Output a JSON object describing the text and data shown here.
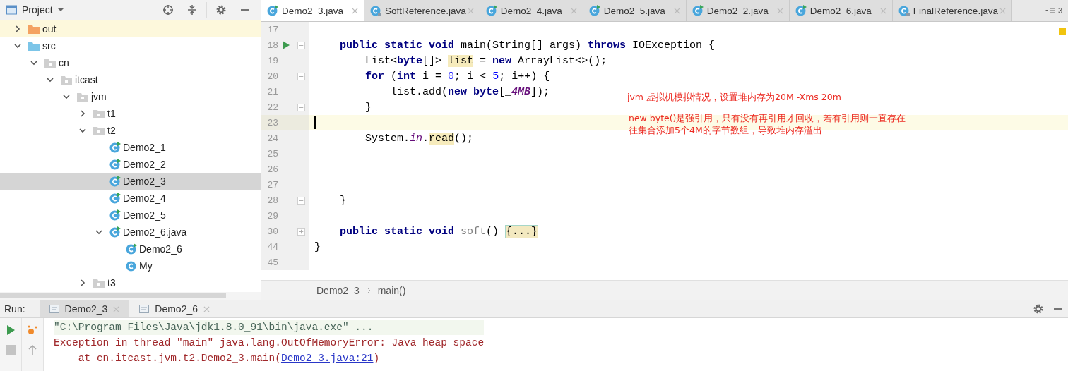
{
  "project_panel": {
    "title": "Project",
    "tree": [
      {
        "label": "out",
        "kind": "excluded-folder",
        "expanded": false,
        "selected": false
      },
      {
        "label": "src",
        "kind": "source-folder",
        "expanded": true,
        "selected": false,
        "children": [
          {
            "label": "cn",
            "kind": "package",
            "expanded": true,
            "selected": false,
            "children": [
              {
                "label": "itcast",
                "kind": "package",
                "expanded": true,
                "selected": false,
                "children": [
                  {
                    "label": "jvm",
                    "kind": "package",
                    "expanded": true,
                    "selected": false,
                    "children": [
                      {
                        "label": "t1",
                        "kind": "package",
                        "expanded": false,
                        "selected": false
                      },
                      {
                        "label": "t2",
                        "kind": "package",
                        "expanded": true,
                        "selected": false,
                        "children": [
                          {
                            "label": "Demo2_1",
                            "kind": "runnable-class",
                            "selected": false
                          },
                          {
                            "label": "Demo2_2",
                            "kind": "runnable-class",
                            "selected": false
                          },
                          {
                            "label": "Demo2_3",
                            "kind": "runnable-class",
                            "selected": true
                          },
                          {
                            "label": "Demo2_4",
                            "kind": "runnable-class",
                            "selected": false
                          },
                          {
                            "label": "Demo2_5",
                            "kind": "runnable-class",
                            "selected": false
                          },
                          {
                            "label": "Demo2_6.java",
                            "kind": "runnable-class",
                            "expanded": true,
                            "selected": false,
                            "children": [
                              {
                                "label": "Demo2_6",
                                "kind": "runnable-class",
                                "selected": false
                              },
                              {
                                "label": "My",
                                "kind": "class",
                                "selected": false
                              }
                            ]
                          }
                        ]
                      },
                      {
                        "label": "t3",
                        "kind": "package",
                        "expanded": false,
                        "selected": false
                      }
                    ]
                  }
                ]
              }
            ]
          }
        ]
      }
    ]
  },
  "editor": {
    "tabs": [
      {
        "label": "Demo2_3.java",
        "kind": "runnable-class",
        "selected": true
      },
      {
        "label": "SoftReference.java",
        "kind": "library-class",
        "selected": false
      },
      {
        "label": "Demo2_4.java",
        "kind": "runnable-class",
        "selected": false
      },
      {
        "label": "Demo2_5.java",
        "kind": "runnable-class",
        "selected": false
      },
      {
        "label": "Demo2_2.java",
        "kind": "runnable-class",
        "selected": false
      },
      {
        "label": "Demo2_6.java",
        "kind": "runnable-class",
        "selected": false
      },
      {
        "label": "FinalReference.java",
        "kind": "library-class",
        "selected": false
      }
    ],
    "overflow_count": "3",
    "lines": [
      {
        "number": "17",
        "kind": "plain",
        "run": false,
        "current": false
      },
      {
        "number": "18",
        "kind": "fold-start",
        "run": true,
        "current": false,
        "tokens": [
          {
            "text": "    public static void",
            "kind": "keyword"
          },
          {
            "text": " main(String[] args) ",
            "kind": "plain"
          },
          {
            "text": "throws",
            "kind": "keyword"
          },
          {
            "text": " IOException {",
            "kind": "plain"
          }
        ]
      },
      {
        "number": "19",
        "kind": "plain",
        "run": false,
        "current": false,
        "tokens": [
          {
            "text": "        List<",
            "kind": "plain"
          },
          {
            "text": "byte",
            "kind": "keyword"
          },
          {
            "text": "[]> ",
            "kind": "plain"
          },
          {
            "text": "list",
            "kind": "highlight"
          },
          {
            "text": " = ",
            "kind": "plain"
          },
          {
            "text": "new",
            "kind": "keyword"
          },
          {
            "text": " ArrayList<>();",
            "kind": "plain"
          }
        ]
      },
      {
        "number": "20",
        "kind": "fold-start",
        "run": false,
        "current": false,
        "tokens": [
          {
            "text": "        for",
            "kind": "keyword"
          },
          {
            "text": " (",
            "kind": "plain"
          },
          {
            "text": "int ",
            "kind": "keyword"
          },
          {
            "text": "i",
            "kind": "variable"
          },
          {
            "text": " = ",
            "kind": "plain"
          },
          {
            "text": "0",
            "kind": "number"
          },
          {
            "text": "; ",
            "kind": "plain"
          },
          {
            "text": "i",
            "kind": "variable"
          },
          {
            "text": " < ",
            "kind": "plain"
          },
          {
            "text": "5",
            "kind": "number"
          },
          {
            "text": "; ",
            "kind": "plain"
          },
          {
            "text": "i",
            "kind": "variable"
          },
          {
            "text": "++) {",
            "kind": "plain"
          }
        ]
      },
      {
        "number": "21",
        "kind": "plain",
        "run": false,
        "current": false,
        "tokens": [
          {
            "text": "            list.add(",
            "kind": "plain"
          },
          {
            "text": "new byte",
            "kind": "keyword"
          },
          {
            "text": "[_",
            "kind": "plain"
          },
          {
            "text": "4MB",
            "kind": "constant"
          },
          {
            "text": "]);",
            "kind": "plain"
          }
        ]
      },
      {
        "number": "22",
        "kind": "fold-end",
        "run": false,
        "current": false,
        "tokens": [
          {
            "text": "        }",
            "kind": "plain"
          }
        ]
      },
      {
        "number": "23",
        "kind": "plain",
        "run": false,
        "current": true
      },
      {
        "number": "24",
        "kind": "plain",
        "run": false,
        "current": false,
        "tokens": [
          {
            "text": "        System.",
            "kind": "plain"
          },
          {
            "text": "in",
            "kind": "static"
          },
          {
            "text": ".",
            "kind": "plain"
          },
          {
            "text": "read",
            "kind": "highlight"
          },
          {
            "text": "();",
            "kind": "plain"
          }
        ]
      },
      {
        "number": "25",
        "kind": "plain",
        "run": false,
        "current": false
      },
      {
        "number": "26",
        "kind": "plain",
        "run": false,
        "current": false
      },
      {
        "number": "27",
        "kind": "plain",
        "run": false,
        "current": false
      },
      {
        "number": "28",
        "kind": "fold-end",
        "run": false,
        "current": false,
        "tokens": [
          {
            "text": "    }",
            "kind": "plain"
          }
        ]
      },
      {
        "number": "29",
        "kind": "plain",
        "run": false,
        "current": false
      },
      {
        "number": "30",
        "kind": "folded",
        "run": false,
        "current": false,
        "tokens": [
          {
            "text": "    public static void ",
            "kind": "keyword"
          },
          {
            "text": "soft",
            "kind": "unused"
          },
          {
            "text": "() ",
            "kind": "plain"
          },
          {
            "text": "{...}",
            "kind": "folded"
          }
        ]
      },
      {
        "number": "44",
        "kind": "plain",
        "run": false,
        "current": false,
        "tokens": [
          {
            "text": "}",
            "kind": "plain"
          }
        ]
      },
      {
        "number": "45",
        "kind": "plain",
        "run": false,
        "current": false
      }
    ],
    "annotations": [
      {
        "lines": [
          "jvm 虚拟机模拟情况，设置堆内存为20M -Xms 20m"
        ]
      },
      {
        "lines": [
          "new byte()是强引用，只有没有再引用才回收，若有引用则一直存在",
          "往集合添加5个4M的字节数组，导致堆内存溢出"
        ]
      }
    ],
    "breadcrumb": [
      "Demo2_3",
      "main()"
    ]
  },
  "run_panel": {
    "label": "Run:",
    "tabs": [
      {
        "label": "Demo2_3",
        "selected": true
      },
      {
        "label": "Demo2_6",
        "selected": false
      }
    ],
    "console": [
      {
        "kind": "command",
        "parts": [
          {
            "text": "\"C:\\Program Files\\Java\\jdk1.8.0_91\\bin\\java.exe\" ...",
            "kind": "text"
          }
        ]
      },
      {
        "kind": "error",
        "parts": [
          {
            "text": "Exception in thread \"main\" java.lang.OutOfMemoryError: Java heap space",
            "kind": "text"
          }
        ]
      },
      {
        "kind": "error",
        "parts": [
          {
            "text": "    at cn.itcast.jvm.t2.Demo2_3.main(",
            "kind": "text"
          },
          {
            "text": "Demo2_3.java:21",
            "kind": "link"
          },
          {
            "text": ")",
            "kind": "text"
          }
        ]
      }
    ]
  }
}
